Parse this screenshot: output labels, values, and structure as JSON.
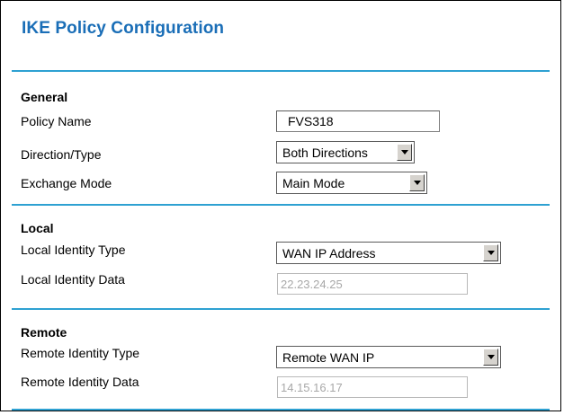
{
  "page": {
    "title": "IKE Policy Configuration"
  },
  "general": {
    "heading": "General",
    "policy_name_label": "Policy Name",
    "policy_name_value": "FVS318",
    "direction_label": "Direction/Type",
    "direction_value": "Both Directions",
    "exchange_label": "Exchange Mode",
    "exchange_value": "Main Mode"
  },
  "local": {
    "heading": "Local",
    "identity_type_label": "Local Identity Type",
    "identity_type_value": "WAN IP Address",
    "identity_data_label": "Local Identity Data",
    "identity_data_value": "22.23.24.25"
  },
  "remote": {
    "heading": "Remote",
    "identity_type_label": "Remote Identity Type",
    "identity_type_value": "Remote WAN IP",
    "identity_data_label": "Remote Identity Data",
    "identity_data_value": "14.15.16.17"
  },
  "colors": {
    "title": "#1a6eb7",
    "rule": "#2ea1d2"
  },
  "icons": {
    "dropdown": "chevron-down-icon"
  }
}
